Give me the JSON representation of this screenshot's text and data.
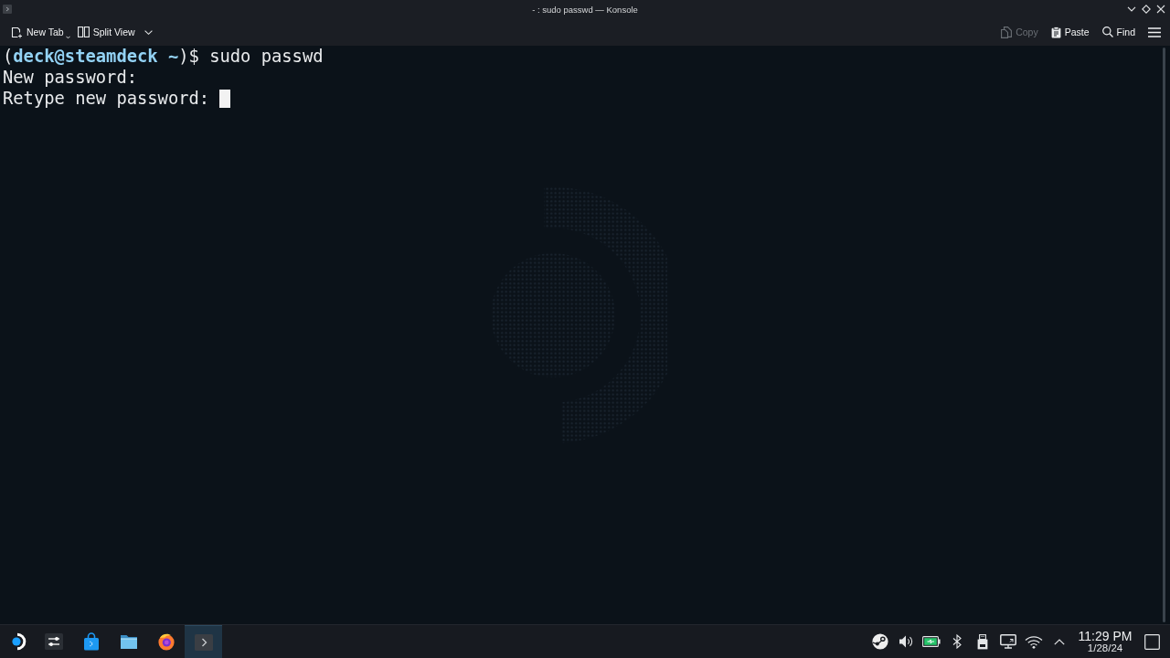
{
  "window": {
    "title": "- : sudo passwd — Konsole"
  },
  "toolbar": {
    "left": [
      {
        "kind": "new_tab",
        "label": "New Tab"
      },
      {
        "kind": "split_view",
        "label": "Split View"
      }
    ],
    "right": [
      {
        "kind": "copy",
        "label": "Copy",
        "disabled": true
      },
      {
        "kind": "paste",
        "label": "Paste",
        "disabled": false
      },
      {
        "kind": "find",
        "label": "Find",
        "disabled": false
      }
    ]
  },
  "terminal": {
    "lines": [
      "(**deck@steamdeck ~**)$ sudo passwd",
      "New password:",
      "Retype new password:"
    ],
    "cursor": true
  },
  "taskbar": {
    "tasks": [
      {
        "kind": "launcher",
        "active": false
      },
      {
        "kind": "settings",
        "active": false
      },
      {
        "kind": "store",
        "active": false
      },
      {
        "kind": "files",
        "active": false
      },
      {
        "kind": "browser",
        "active": false
      },
      {
        "kind": "terminal",
        "active": true
      }
    ],
    "clock": {
      "time": "11:29 PM",
      "date": "1/28/24"
    }
  }
}
